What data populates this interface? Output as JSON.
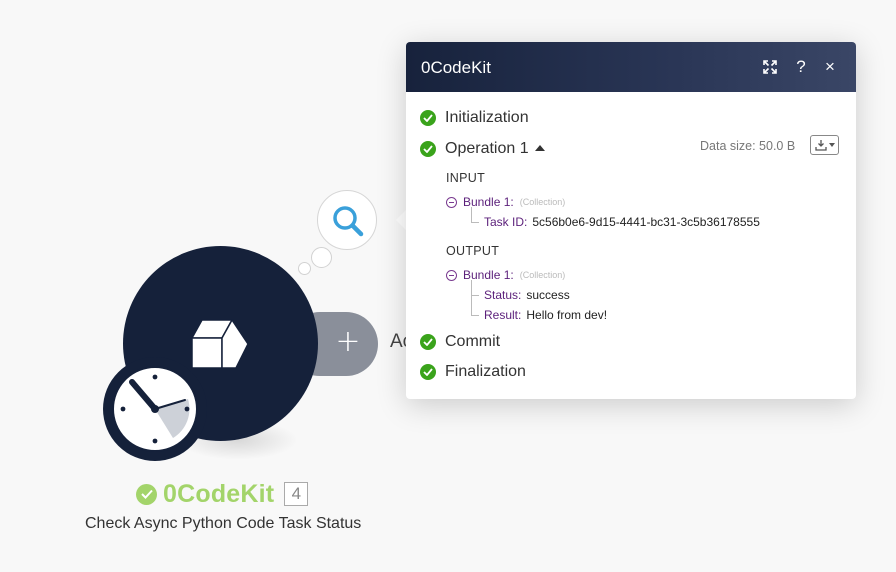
{
  "module": {
    "name": "0CodeKit",
    "operation_count": "4",
    "description": "Check Async Python Code Task Status",
    "status_color": "#a3d46a",
    "add_label": "Ac"
  },
  "inspector": {
    "title": "0CodeKit",
    "buttons": {
      "expand": "⤢",
      "help": "?",
      "close": "×"
    },
    "phases": {
      "initialization": "Initialization",
      "operation": "Operation 1",
      "commit": "Commit",
      "finalization": "Finalization"
    },
    "data_size": "Data size: 50.0 B",
    "input": {
      "label": "INPUT",
      "bundle_name": "Bundle 1:",
      "bundle_type": "(Collection)",
      "fields": [
        {
          "key": "Task ID:",
          "value": "5c56b0e6-9d15-4441-bc31-3c5b36178555"
        }
      ]
    },
    "output": {
      "label": "OUTPUT",
      "bundle_name": "Bundle 1:",
      "bundle_type": "(Collection)",
      "fields": [
        {
          "key": "Status:",
          "value": "success"
        },
        {
          "key": "Result:",
          "value": "Hello from dev!"
        }
      ]
    },
    "success_color": "#3aa31b"
  }
}
